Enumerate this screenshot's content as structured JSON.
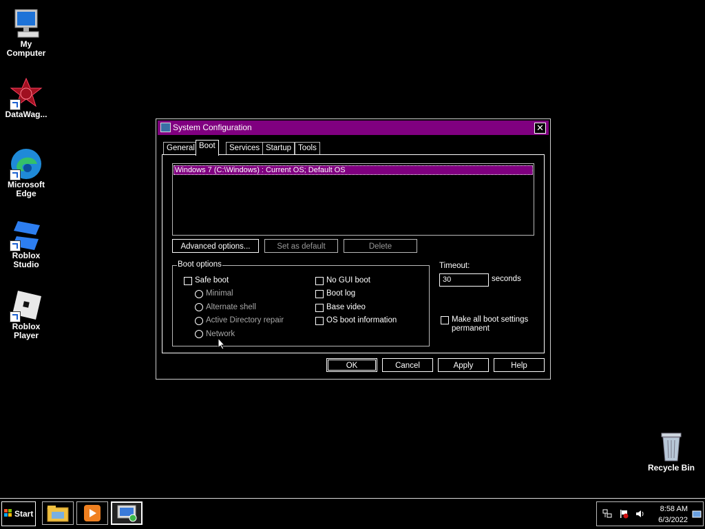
{
  "desktop": {
    "icons": [
      {
        "label": "My Computer"
      },
      {
        "label": "DataWag..."
      },
      {
        "label": "Microsoft Edge"
      },
      {
        "label": "Roblox Studio"
      },
      {
        "label": "Roblox Player"
      },
      {
        "label": "Recycle Bin"
      }
    ]
  },
  "dialog": {
    "title": "System Configuration",
    "close_glyph": "✕",
    "tabs": [
      {
        "label": "General"
      },
      {
        "label": "Boot",
        "active": true
      },
      {
        "label": "Services"
      },
      {
        "label": "Startup"
      },
      {
        "label": "Tools"
      }
    ],
    "os_list": [
      "Windows 7 (C:\\Windows) : Current OS; Default OS"
    ],
    "buttons": {
      "advanced": "Advanced options...",
      "set_default": "Set as default",
      "delete": "Delete"
    },
    "boot_options": {
      "legend": "Boot options",
      "safe_boot": "Safe boot",
      "minimal": "Minimal",
      "alternate_shell": "Alternate shell",
      "active_directory_repair": "Active Directory repair",
      "network": "Network",
      "no_gui_boot": "No GUI boot",
      "boot_log": "Boot log",
      "base_video": "Base video",
      "os_boot_information": "OS boot information"
    },
    "timeout": {
      "label": "Timeout:",
      "value": "30",
      "unit": "seconds"
    },
    "permanent": "Make all boot settings permanent",
    "footer": {
      "ok": "OK",
      "cancel": "Cancel",
      "apply": "Apply",
      "help": "Help"
    }
  },
  "taskbar": {
    "start": "Start",
    "apps": [
      "file-explorer-icon",
      "media-player-icon",
      "system-configuration-icon"
    ],
    "clock": {
      "time": "8:58 AM",
      "date": "6/3/2022"
    }
  },
  "colors": {
    "accent": "#800080",
    "background": "#000000",
    "text": "#ffffff",
    "disabled": "#a8a8a8"
  }
}
